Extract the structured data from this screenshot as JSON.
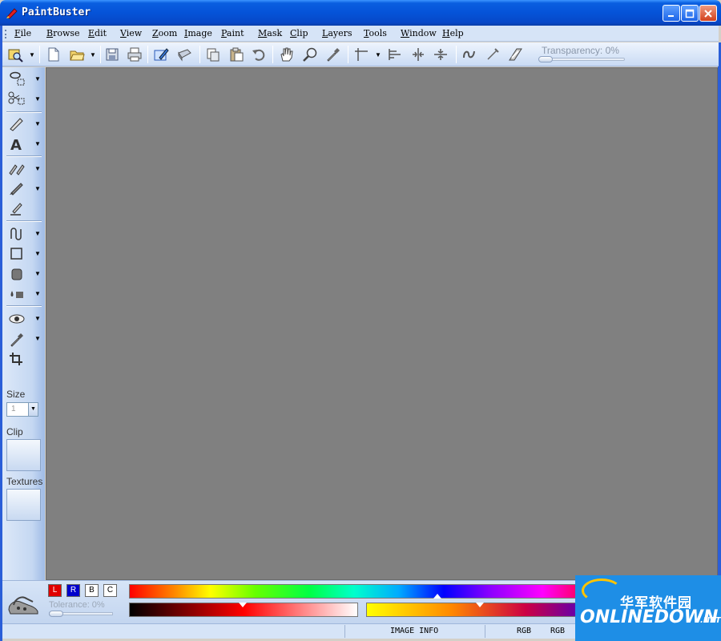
{
  "window": {
    "title": "PaintBuster"
  },
  "menu": {
    "items": [
      "File",
      "Browse",
      "Edit",
      "View",
      "Zoom",
      "Image",
      "Paint",
      "Mask",
      "Clip",
      "Layers",
      "Tools",
      "Window",
      "Help"
    ]
  },
  "toolbar": {
    "transparency_label": "Transparency: 0%",
    "transparency_value": 0
  },
  "left_panel": {
    "size_label": "Size",
    "size_value": "1",
    "clip_label": "Clip",
    "textures_label": "Textures"
  },
  "color_panel": {
    "channel_buttons": [
      "L",
      "R",
      "B",
      "C"
    ],
    "tolerance_label": "Tolerance: 0%",
    "tolerance_value": 0,
    "colors": {
      "left": "#ff0000",
      "right": "#0000cc"
    }
  },
  "statusbar": {
    "image_info": "IMAGE INFO",
    "mode1": "RGB",
    "mode2": "RGB"
  },
  "watermark": {
    "cn_text": "华军软件园",
    "en_text": "ONLINEDOWN",
    "suffix": ".NET"
  }
}
